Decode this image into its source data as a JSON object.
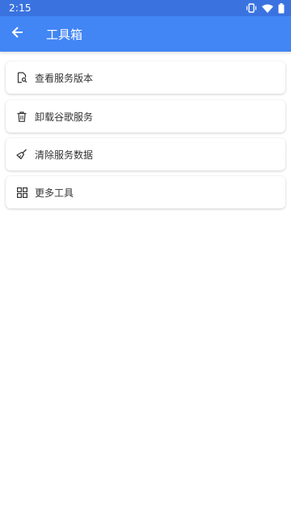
{
  "status_bar": {
    "time": "2:15",
    "icons": [
      "vibrate-icon",
      "wifi-icon",
      "battery-icon"
    ]
  },
  "app_bar": {
    "back_icon": "arrow-left-icon",
    "title": "工具箱"
  },
  "tools": [
    {
      "id": "view-service-version",
      "icon": "file-search-icon",
      "label": "查看服务版本"
    },
    {
      "id": "uninstall-google-services",
      "icon": "trash-icon",
      "label": "卸载谷歌服务"
    },
    {
      "id": "clear-service-data",
      "icon": "broom-icon",
      "label": "清除服务数据"
    },
    {
      "id": "more-tools",
      "icon": "grid-icon",
      "label": "更多工具"
    }
  ],
  "colors": {
    "status_bar": "#3a73e0",
    "app_bar": "#4285f4",
    "background": "#ffffff",
    "text": "#333333"
  }
}
